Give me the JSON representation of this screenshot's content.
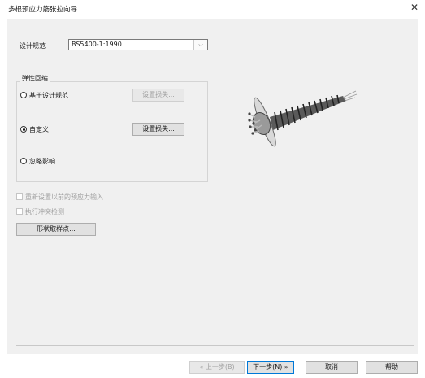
{
  "window": {
    "title": "多根预应力筋张拉向导"
  },
  "design_code": {
    "label": "设计规范",
    "value": "BS5400-1:1990"
  },
  "elastic_shortening": {
    "group_title": "弹性回缩",
    "options": [
      {
        "label": "基于设计规范",
        "selected": false
      },
      {
        "label": "自定义",
        "selected": true
      },
      {
        "label": "忽略影响",
        "selected": false
      }
    ],
    "loss_button_disabled": "设置损失...",
    "loss_button": "设置损失..."
  },
  "checkboxes": {
    "reset_input": "重新设置以前的预应力输入",
    "clash_check": "执行冲突检测"
  },
  "sample_points_button": "形状取样点...",
  "footer": {
    "back": "« 上一步(B)",
    "next": "下一步(N) »",
    "cancel": "取消",
    "help": "帮助"
  },
  "icons": {
    "close": "close-icon",
    "dropdown": "chevron-down-icon",
    "illustration": "tendon-anchor-illustration"
  }
}
